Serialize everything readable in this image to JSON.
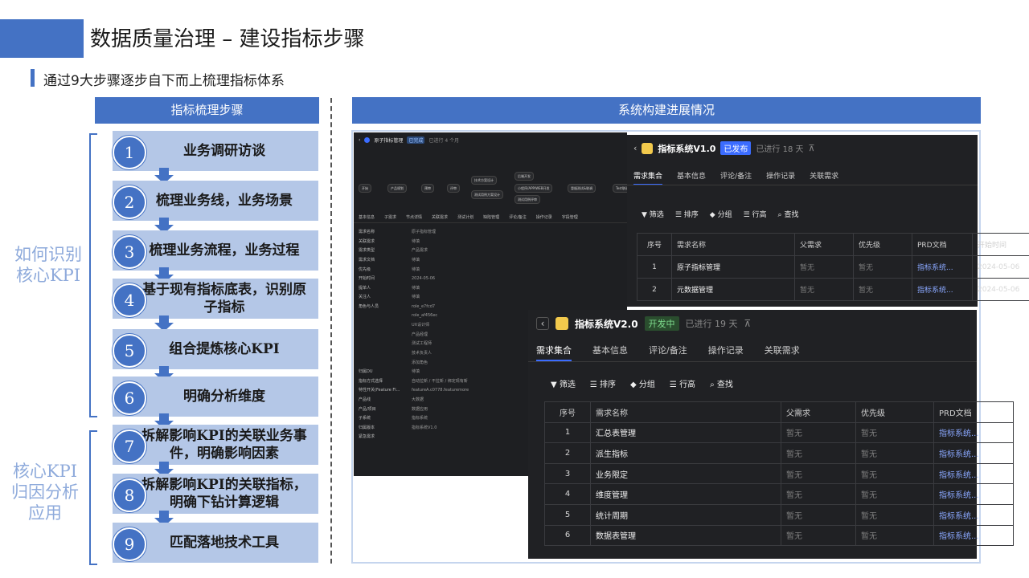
{
  "header": {
    "title": "数据质量治理 – 建设指标步骤",
    "subtitle": "通过9大步骤逐步自下而上梳理指标体系"
  },
  "left_panel": {
    "heading": "指标梳理步骤",
    "steps": [
      {
        "num": "1",
        "text": "业务调研访谈"
      },
      {
        "num": "2",
        "text": "梳理业务线，业务场景"
      },
      {
        "num": "3",
        "text": "梳理业务流程，业务过程"
      },
      {
        "num": "4",
        "text": "基于现有指标底表，识别原子指标"
      },
      {
        "num": "5",
        "text": "组合提炼核心KPI"
      },
      {
        "num": "6",
        "text": "明确分析维度"
      },
      {
        "num": "7",
        "text": "拆解影响KPI的关联业务事件，明确影响因素"
      },
      {
        "num": "8",
        "text": "拆解影响KPI的关联指标，明确下钻计算逻辑"
      },
      {
        "num": "9",
        "text": "匹配落地技术工具"
      }
    ],
    "groups": [
      {
        "label": "如何识别核心KPI"
      },
      {
        "label": "核心KPI归因分析应用"
      }
    ]
  },
  "right_panel": {
    "heading": "系统构建进展情况",
    "back_window": {
      "title": "原子指标管理",
      "status": "已完成",
      "elapsed": "已进行 4 个月",
      "flow_nodes": [
        "开始",
        "产品规划",
        "预审",
        "评审",
        "技术方案设计",
        "测试用例方案设计",
        "后端开发",
        "小程序/APP/WEB开发",
        "测试用例评审",
        "冒烟测试&联调",
        "Test联调"
      ],
      "tabs": [
        "基本信息",
        "子需求",
        "节点详情",
        "关联需求",
        "测试计划",
        "缺陷管理",
        "评论/备注",
        "操作记录",
        "字段管理"
      ],
      "fields": [
        {
          "k": "需求名称",
          "v": "原子指标管理"
        },
        {
          "k": "关联需求",
          "v": "待填"
        },
        {
          "k": "需求类型",
          "v": "产品需求"
        },
        {
          "k": "需求文档",
          "v": "待填"
        },
        {
          "k": "优先级",
          "v": "待填"
        },
        {
          "k": "开始时间",
          "v": "2024-05-06"
        },
        {
          "k": "提单人",
          "v": "待填"
        },
        {
          "k": "关注人",
          "v": "待填"
        },
        {
          "k": "角色与人员",
          "v": "role_e7fcd7"
        },
        {
          "k": "",
          "v": "role_af456ec"
        },
        {
          "k": "",
          "v": "UX设计师"
        },
        {
          "k": "",
          "v": "产品经理"
        },
        {
          "k": "",
          "v": "测试工程师"
        },
        {
          "k": "",
          "v": "技术负责人"
        },
        {
          "k": "",
          "v": "添加角色"
        },
        {
          "k": "归属DU",
          "v": "待填"
        },
        {
          "k": "指标方式选择",
          "v": "自动拉新 / 不拉新 / 绑定现有新"
        },
        {
          "k": "特性开关(Feature Fl...",
          "v": "featureA.c0778.featuremore"
        },
        {
          "k": "产品线",
          "v": "大数据"
        },
        {
          "k": "产品/项目",
          "v": "数据应用"
        },
        {
          "k": "子系统",
          "v": "指标系统"
        },
        {
          "k": "归属版本",
          "v": "指标系统V1.0"
        },
        {
          "k": "紧急需求",
          "v": ""
        }
      ]
    },
    "v1_window": {
      "title": "指标系统V1.0",
      "status": "已发布",
      "elapsed": "已进行 18 天",
      "tabs": [
        "需求集合",
        "基本信息",
        "评论/备注",
        "操作记录",
        "关联需求"
      ],
      "toolbar": [
        "筛选",
        "排序",
        "分组",
        "行高",
        "查找"
      ],
      "columns": [
        "序号",
        "需求名称",
        "父需求",
        "优先级",
        "PRD文档",
        "开始时间"
      ],
      "rows": [
        [
          "1",
          "原子指标管理",
          "暂无",
          "暂无",
          "指标系统...",
          "2024-05-06"
        ],
        [
          "2",
          "元数据管理",
          "暂无",
          "暂无",
          "指标系统...",
          "2024-05-06"
        ]
      ]
    },
    "v2_window": {
      "title": "指标系统V2.0",
      "status": "开发中",
      "elapsed": "已进行 19 天",
      "tabs": [
        "需求集合",
        "基本信息",
        "评论/备注",
        "操作记录",
        "关联需求"
      ],
      "toolbar": [
        "筛选",
        "排序",
        "分组",
        "行高",
        "查找"
      ],
      "columns": [
        "序号",
        "需求名称",
        "父需求",
        "优先级",
        "PRD文档"
      ],
      "rows": [
        [
          "1",
          "汇总表管理",
          "暂无",
          "暂无",
          "指标系统..."
        ],
        [
          "2",
          "派生指标",
          "暂无",
          "暂无",
          "指标系统..."
        ],
        [
          "3",
          "业务限定",
          "暂无",
          "暂无",
          "指标系统..."
        ],
        [
          "4",
          "维度管理",
          "暂无",
          "暂无",
          "指标系统..."
        ],
        [
          "5",
          "统计周期",
          "暂无",
          "暂无",
          "指标系统..."
        ],
        [
          "6",
          "数据表管理",
          "暂无",
          "暂无",
          "指标系统..."
        ]
      ]
    }
  },
  "colors": {
    "accent": "#4472c4",
    "step_bg": "#b4c7e7",
    "group_label": "#8eaadb",
    "dark_bg": "#202124"
  }
}
